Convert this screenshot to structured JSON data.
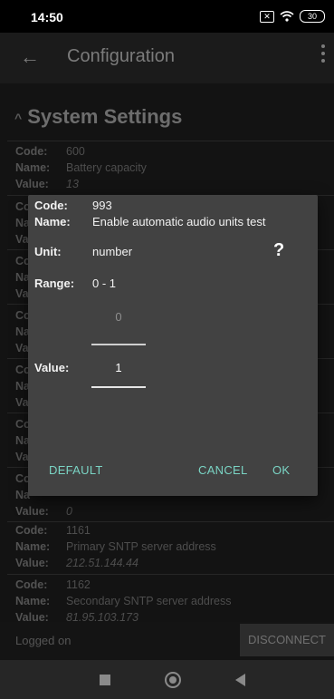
{
  "status_bar": {
    "time": "14:50",
    "sim_icon": "x-box-icon",
    "wifi_icon": "wifi-icon",
    "battery_level": "30"
  },
  "app_bar": {
    "title": "Configuration"
  },
  "section": {
    "title": "System Settings"
  },
  "labels": {
    "code": "Code:",
    "name": "Name:",
    "value": "Value:"
  },
  "entries": [
    {
      "code": "600",
      "name": "Battery capacity",
      "value": "13"
    },
    {
      "code": "Co",
      "name": "Na",
      "value": "Va"
    },
    {
      "code": "Co",
      "name": "Na",
      "value": "Va"
    },
    {
      "code": "Co",
      "name": "Na",
      "value": "Va"
    },
    {
      "code": "Co",
      "name": "Na",
      "value": "Va"
    },
    {
      "code": "Co",
      "name": "Na",
      "value": "Va"
    },
    {
      "code": "Co",
      "name": "Na",
      "value": "0"
    },
    {
      "code": "1161",
      "name": "Primary SNTP server address",
      "value": "212.51.144.44"
    },
    {
      "code": "1162",
      "name": "Secondary SNTP server address",
      "value": "81.95.103.173"
    }
  ],
  "bottom_bar": {
    "status": "Logged on",
    "disconnect": "DISCONNECT"
  },
  "dialog": {
    "code_label": "Code:",
    "code": "993",
    "name_label": "Name:",
    "name": "Enable automatic audio units test",
    "unit_label": "Unit:",
    "unit": "number",
    "help": "?",
    "range_label": "Range:",
    "range": "0 - 1",
    "previous_value": "0",
    "value_label": "Value:",
    "value": "1",
    "default_button": "DEFAULT",
    "cancel_button": "CANCEL",
    "ok_button": "OK"
  }
}
